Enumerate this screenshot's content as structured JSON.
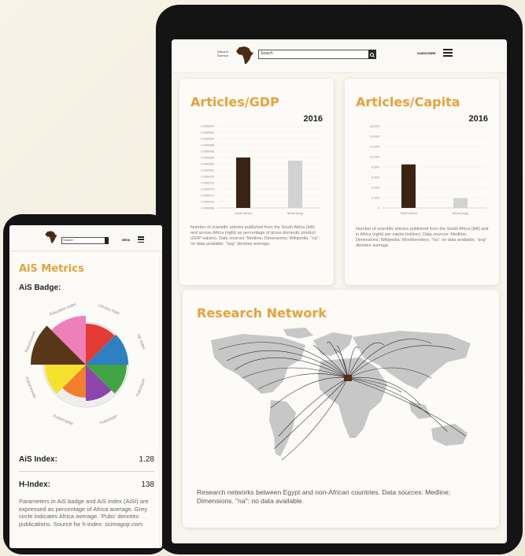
{
  "tablet": {
    "header": {
      "logo_text": "Africa in Science",
      "search_value": "Search",
      "subscribe_label": "SUBSCRIBE"
    },
    "articles_gdp": {
      "title": "Articles/GDP",
      "year": "2016",
      "description": "Number of scientific articles published from the South Africa (left) and across Africa (right) as percentage of gross domestic product (GDP values). Data sources: Medline; Dimensions; Wikipedia. \"na\": no data available. \"avg\" denotes average."
    },
    "articles_capita": {
      "title": "Articles/Capita",
      "year": "2016",
      "description": "Number of scientific articles published from the South Africa (left) and in Africa (right) per capita (million). Data sources: Medline; Dimensions; Wikipedia; Worldometers. \"na\": no data available. \"avg\" denotes average."
    },
    "research_network": {
      "title": "Research Network",
      "description": "Research networks between Egypt and non-African countries. Data sources: Medline; Dimensions. \"na\": no data available."
    }
  },
  "phone": {
    "header": {
      "search_value": "Search",
      "menu_label": "MENU"
    },
    "title": "AiS Metrics",
    "badge_label": "AiS Badge:",
    "segment_labels": [
      "Literacy Rate",
      "HE Index",
      "Pubs/GDP",
      "Pubs/GDP",
      "Pubs/Capita",
      "Pubs/Growth",
      "Pubs/Growth",
      "Education Index"
    ],
    "ais_index_label": "AiS Index:",
    "ais_index_value": "1.28",
    "h_index_label": "H-Index:",
    "h_index_value": "138",
    "description": "Parameters in AiS badge and AiS index (AiSI) are expressed as percentage of Africa average. Grey circle indicates Africa average. 'Pubs' denotes publications. Source for h-index: scimagojr.com"
  },
  "colors": {
    "accent": "#e4a23b",
    "bar_dark": "#3b2414",
    "bar_light": "#d2d2d2",
    "badge": [
      "#e53a35",
      "#2f7fc3",
      "#3fa441",
      "#8e44ad",
      "#f17f2e",
      "#f7e12f",
      "#5a3618",
      "#ef7fb9"
    ]
  },
  "chart_data": [
    {
      "type": "bar",
      "title": "Articles/GDP",
      "categories": [
        "South Africa",
        "Africa (avg)"
      ],
      "values": [
        8.4e-05,
        8.3e-05
      ],
      "ytick_labels": [
        "0.000094",
        "0.000092",
        "0.000090",
        "0.000088",
        "0.000086",
        "0.000084",
        "0.000082",
        "0.000080",
        "0.000078",
        "0.000076",
        "0.000074",
        "0.000072",
        "0.000070",
        "0.000068"
      ]
    },
    {
      "type": "bar",
      "title": "Articles/Capita",
      "categories": [
        "South Africa",
        "Africa (avg)"
      ],
      "values": [
        8500,
        1900
      ],
      "ylim": [
        0,
        16000
      ],
      "ytick_labels": [
        "16,000",
        "14,000",
        "12,000",
        "10,000",
        "8,000",
        "6,000",
        "4,000",
        "2,000",
        "0"
      ]
    }
  ]
}
